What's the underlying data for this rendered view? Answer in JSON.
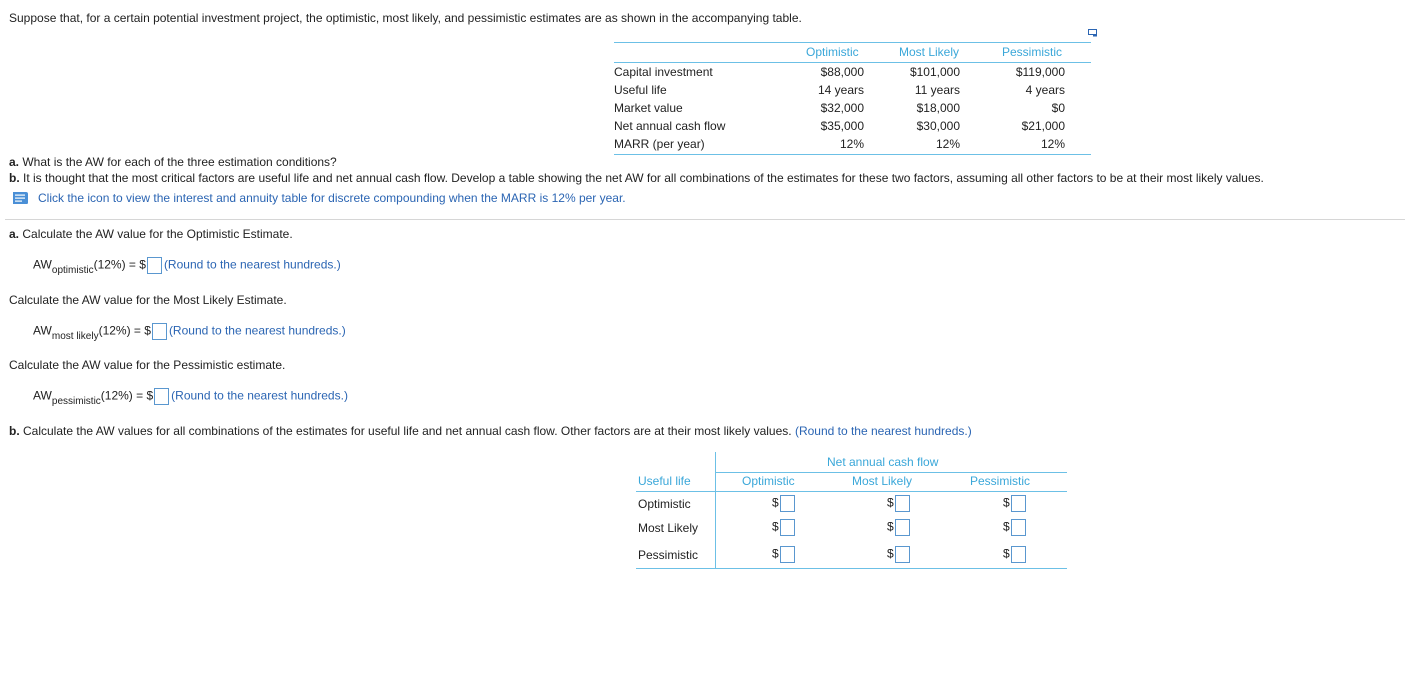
{
  "intro": "Suppose that, for a certain potential investment project, the optimistic, most likely, and pessimistic estimates are as shown in the accompanying table.",
  "icons": {
    "expand": "expand-table-icon",
    "book": "book-icon"
  },
  "colors": {
    "accent_blue": "#2b65b3",
    "header_blue": "#3aa7d9",
    "rule_blue": "#6cc0e6"
  },
  "estimates": {
    "headers": [
      "Optimistic",
      "Most Likely",
      "Pessimistic"
    ],
    "rows": [
      {
        "label": "Capital investment",
        "values": [
          "$88,000",
          "$101,000",
          "$119,000"
        ]
      },
      {
        "label": "Useful life",
        "values": [
          "14 years",
          "11 years",
          "4 years"
        ]
      },
      {
        "label": "Market value",
        "values": [
          "$32,000",
          "$18,000",
          "$0"
        ]
      },
      {
        "label": "Net annual cash flow",
        "values": [
          "$35,000",
          "$30,000",
          "$21,000"
        ]
      },
      {
        "label": "MARR (per year)",
        "values": [
          "12%",
          "12%",
          "12%"
        ]
      }
    ]
  },
  "questions": {
    "a_prefix": "a.",
    "a_text": " What is the AW for each of the three estimation conditions?",
    "b_prefix": "b.",
    "b_text": " It is thought that the most critical factors are useful life and net annual cash flow. Develop a table showing the net AW for all combinations of the estimates for these two factors, assuming all other factors to be at their most likely values."
  },
  "link_text": "Click the icon to view the interest and annuity table for discrete compounding when the MARR is 12% per year.",
  "part_a": {
    "prompt_prefix": "a.",
    "prompt": " Calculate the AW value for the Optimistic Estimate.",
    "optimistic": {
      "aw": "AW",
      "sub": "optimistic",
      "rate": "(12%) = $",
      "value": "",
      "hint": "(Round to the nearest hundreds.)"
    },
    "most_likely_prompt": "Calculate the AW value for the Most Likely Estimate.",
    "most_likely": {
      "aw": "AW",
      "sub": "most likely",
      "rate": "(12%) = $",
      "value": "",
      "hint": "(Round to the nearest hundreds.)"
    },
    "pessimistic_prompt": "Calculate the AW value for the Pessimistic estimate.",
    "pessimistic": {
      "aw": "AW",
      "sub": "pessimistic",
      "rate": "(12%) = $",
      "value": "",
      "hint": "(Round to the nearest hundreds.)"
    }
  },
  "part_b": {
    "prompt_prefix": "b.",
    "prompt": " Calculate the AW values for all combinations of the estimates for useful life and net annual cash flow. Other factors are at their most likely values.",
    "hint": " (Round to the nearest hundreds.)",
    "table": {
      "group_header": "Net annual cash flow",
      "row_header": "Useful life",
      "col_headers": [
        "Optimistic",
        "Most Likely",
        "Pessimistic"
      ],
      "row_labels": [
        "Optimistic",
        "Most Likely",
        "Pessimistic"
      ],
      "currency": "$",
      "values": [
        [
          "",
          "",
          ""
        ],
        [
          "",
          "",
          ""
        ],
        [
          "",
          "",
          ""
        ]
      ]
    }
  }
}
